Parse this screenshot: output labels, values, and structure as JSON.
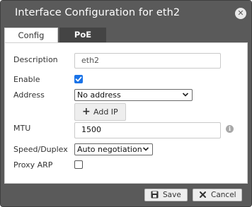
{
  "dialog": {
    "title": "Interface Configuration for eth2",
    "close_icon": "close-icon"
  },
  "tabs": [
    {
      "label": "Config",
      "active": true
    },
    {
      "label": "PoE",
      "active": false
    }
  ],
  "form": {
    "description": {
      "label": "Description",
      "value": "eth2"
    },
    "enable": {
      "label": "Enable",
      "checked": true
    },
    "address": {
      "label": "Address",
      "selected": "No address",
      "add_ip_label": "Add IP"
    },
    "mtu": {
      "label": "MTU",
      "value": "1500"
    },
    "speed_duplex": {
      "label": "Speed/Duplex",
      "selected": "Auto negotiation"
    },
    "proxy_arp": {
      "label": "Proxy ARP",
      "checked": false
    }
  },
  "footer": {
    "save_label": "Save",
    "cancel_label": "Cancel"
  },
  "colors": {
    "titlebar": "#5a5a5a",
    "tab_inactive": "#444444",
    "checkbox_accent": "#1a73e8"
  }
}
